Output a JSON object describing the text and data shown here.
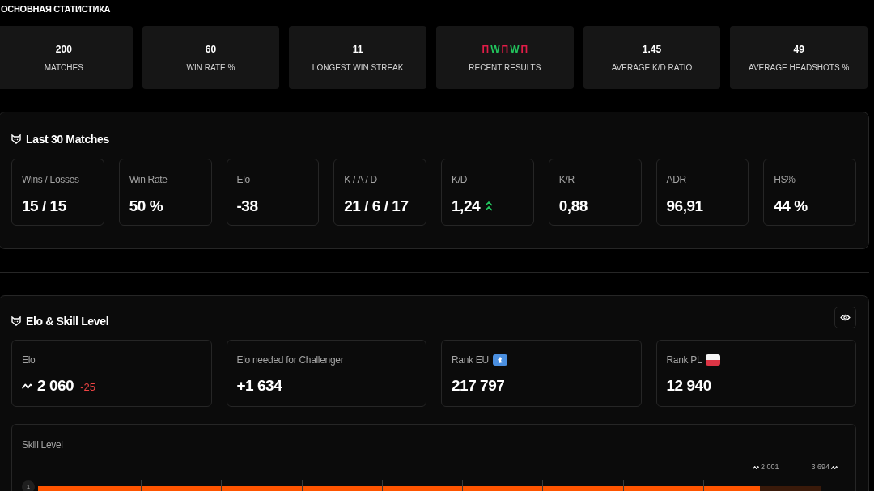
{
  "overview": {
    "title": "ОСНОВНАЯ СТАТИСТИКА",
    "tiles": [
      {
        "kind": "number",
        "value": "200",
        "label": "MATCHES"
      },
      {
        "kind": "number",
        "value": "60",
        "label": "WIN RATE %"
      },
      {
        "kind": "number",
        "value": "11",
        "label": "LONGEST WIN STREAK"
      },
      {
        "kind": "results",
        "results": [
          {
            "text": "П",
            "win": false
          },
          {
            "text": "W",
            "win": true
          },
          {
            "text": "П",
            "win": false
          },
          {
            "text": "W",
            "win": true
          },
          {
            "text": "П",
            "win": false
          }
        ],
        "label": "RECENT RESULTS"
      },
      {
        "kind": "number",
        "value": "1.45",
        "label": "AVERAGE K/D RATIO"
      },
      {
        "kind": "number",
        "value": "49",
        "label": "AVERAGE HEADSHOTS %"
      }
    ]
  },
  "last_matches": {
    "title": "Last 30 Matches",
    "cards": [
      {
        "label": "Wins / Losses",
        "value": "15 / 15",
        "kind": "plain"
      },
      {
        "label": "Win Rate",
        "value": "50 %",
        "kind": "plain"
      },
      {
        "label": "Elo",
        "value": "-38",
        "kind": "plain"
      },
      {
        "label": "K / A / D",
        "value": "21 / 6 / 17",
        "kind": "plain"
      },
      {
        "label": "K/D",
        "value": "1,24",
        "kind": "rising"
      },
      {
        "label": "K/R",
        "value": "0,88",
        "kind": "plain"
      },
      {
        "label": "ADR",
        "value": "96,91",
        "kind": "plain"
      },
      {
        "label": "HS%",
        "value": "44 %",
        "kind": "plain"
      }
    ]
  },
  "elo_section": {
    "title": "Elo & Skill Level",
    "cards": [
      {
        "label": "Elo",
        "value": "2 060",
        "change": "-25",
        "kind": "elo"
      },
      {
        "label": "Elo needed for Challenger",
        "value": "+1 634",
        "kind": "plain"
      },
      {
        "label": "Rank EU",
        "value": "217 797",
        "kind": "region"
      },
      {
        "label": "Rank PL",
        "value": "12 940",
        "kind": "country"
      }
    ],
    "skill": {
      "label": "Skill Level",
      "level_number": "1",
      "current": "2 001",
      "target": "3 694",
      "level": 0.922
    }
  }
}
